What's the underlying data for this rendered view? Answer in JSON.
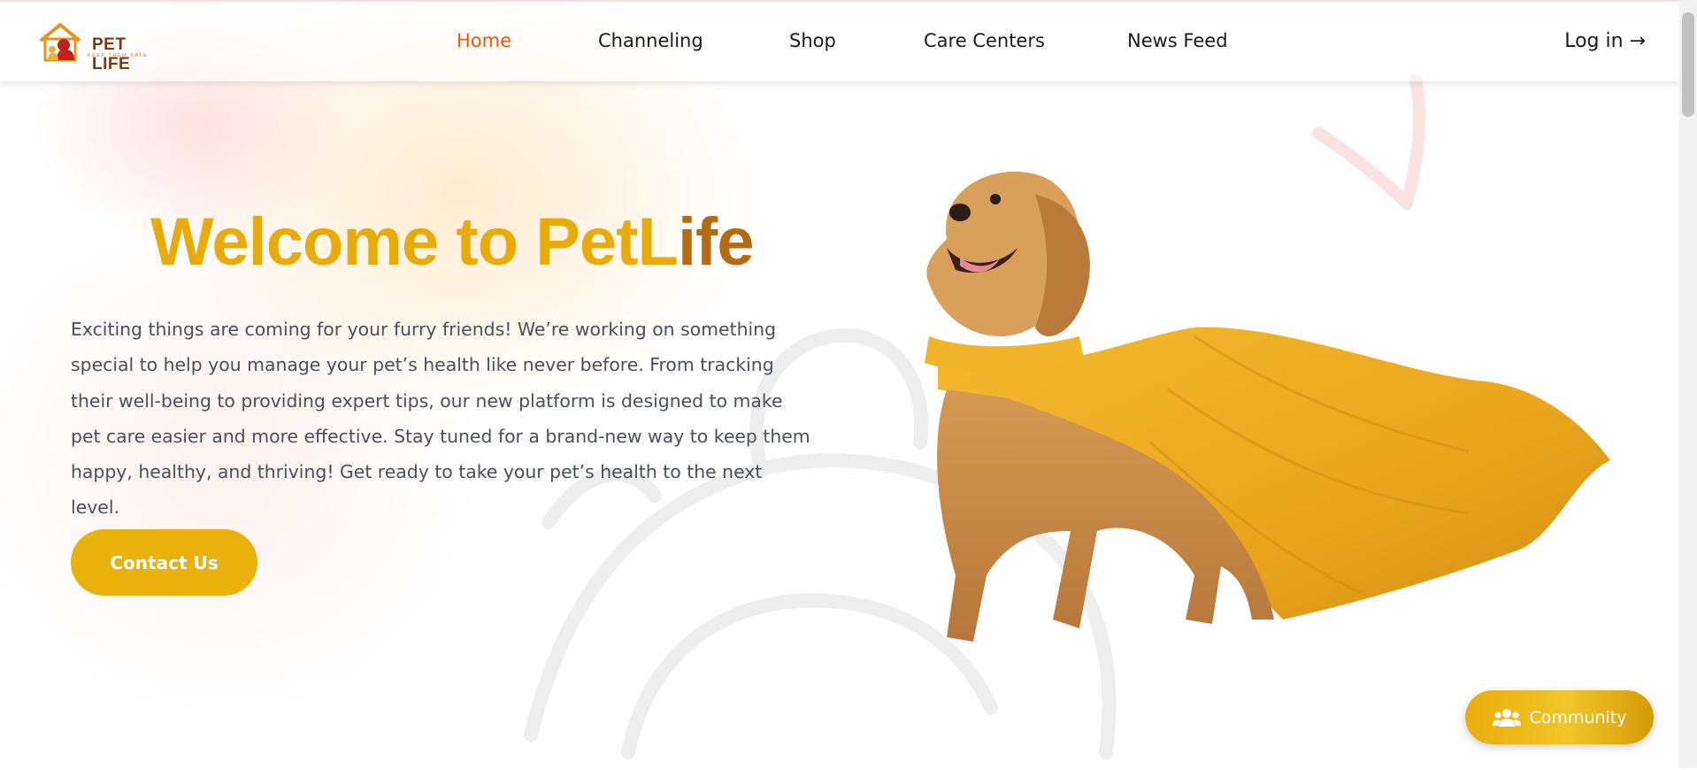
{
  "brand": {
    "name": "PET LIFE",
    "tagline": "KEEP THEM SAFE"
  },
  "nav": {
    "items": [
      {
        "label": "Home",
        "active": true
      },
      {
        "label": "Channeling",
        "active": false
      },
      {
        "label": "Shop",
        "active": false
      },
      {
        "label": "Care Centers",
        "active": false
      },
      {
        "label": "News Feed",
        "active": false
      }
    ],
    "login_label": "Log in →"
  },
  "hero": {
    "title_part1": "Welcome to PetL",
    "title_part2": "ife",
    "description": "Exciting things are coming for your furry friends! We’re working on something special to help you manage your pet’s health like never before. From tracking their well-being to providing expert tips, our new platform is designed to make pet care easier and more effective. Stay tuned for a brand-new way to keep them happy, healthy, and thriving! Get ready to take your pet’s health to the next level.",
    "cta_label": "Contact Us"
  },
  "community": {
    "label": "Community",
    "icon": "users-icon"
  },
  "colors": {
    "accent": "#e9b10c",
    "nav_active": "#e55a0f",
    "title_gold": "#e7ab0c",
    "title_brown": "#b36a10",
    "body_text": "#4a4f5a"
  }
}
